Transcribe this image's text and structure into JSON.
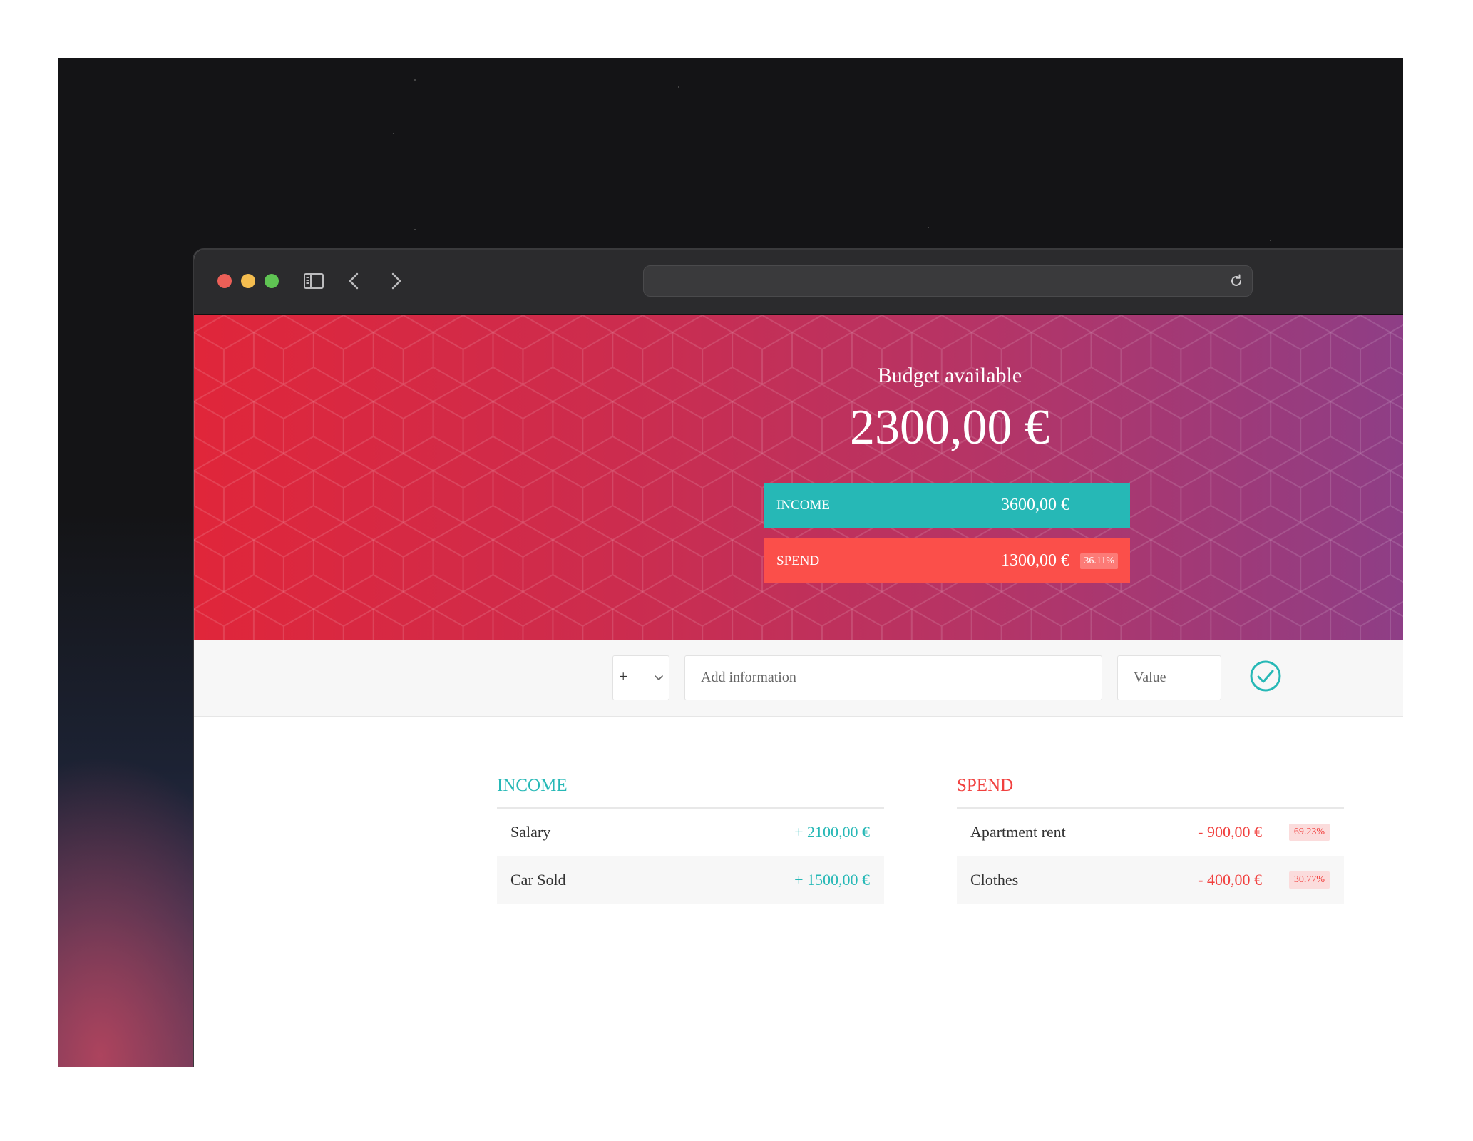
{
  "hero": {
    "title": "Budget available",
    "amount": "2300,00 €"
  },
  "summary": {
    "income": {
      "label": "INCOME",
      "value": "3600,00 €"
    },
    "spend": {
      "label": "SPEND",
      "value": "1300,00 €",
      "percentage": "36.11%"
    }
  },
  "add_form": {
    "type_symbol": "+",
    "description_placeholder": "Add information",
    "value_placeholder": "Value"
  },
  "income_list": {
    "title": "INCOME",
    "items": [
      {
        "description": "Salary",
        "value": "+ 2100,00 €"
      },
      {
        "description": "Car Sold",
        "value": "+ 1500,00 €"
      }
    ]
  },
  "spend_list": {
    "title": "SPEND",
    "items": [
      {
        "description": "Apartment rent",
        "value": "- 900,00 €",
        "percentage": "69.23%"
      },
      {
        "description": "Clothes",
        "value": "- 400,00 €",
        "percentage": "30.77%"
      }
    ]
  },
  "colors": {
    "income": "#26b8b6",
    "spend": "#f1403e",
    "hero_start": "#e0263a",
    "hero_end": "#8e3e86"
  }
}
